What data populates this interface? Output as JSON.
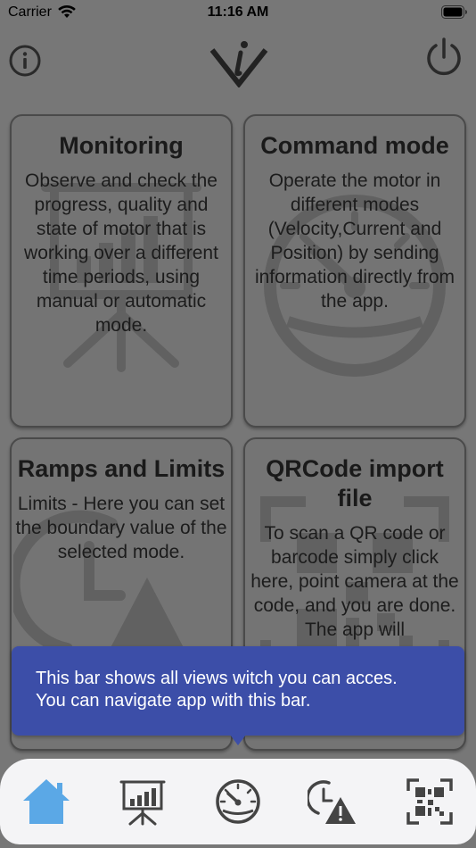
{
  "status_bar": {
    "carrier": "Carrier",
    "time": "11:16 AM"
  },
  "header": {
    "info_icon": "info-icon",
    "logo_icon": "logo-icon",
    "power_icon": "power-icon"
  },
  "cards": [
    {
      "title": "Monitoring",
      "description": "Observe and check the progress, quality and state of motor that is working over a different time periods, using manual or automatic mode.",
      "icon": "presentation-chart-icon"
    },
    {
      "title": "Command mode",
      "description": "Operate the motor in different modes (Velocity,Current and Position) by sending information directly from the app.",
      "icon": "speedometer-icon"
    },
    {
      "title": "Ramps and Limits",
      "description": "Limits - Here you can set the boundary value of the selected mode.",
      "icon": "clock-warning-icon"
    },
    {
      "title": "QRCode import file",
      "description": "To scan a QR code or barcode simply click here, point camera at the code, and you are done. The app will",
      "icon": "qr-code-icon"
    }
  ],
  "tooltip": {
    "line1": "This bar shows all views witch you can acces.",
    "line2": "You can navigate app with this bar."
  },
  "tabbar": {
    "items": [
      "home-icon",
      "presentation-chart-icon",
      "speedometer-icon",
      "clock-warning-icon",
      "qr-code-icon"
    ],
    "active_color": "#5ba8e6",
    "inactive_color": "#444444"
  }
}
